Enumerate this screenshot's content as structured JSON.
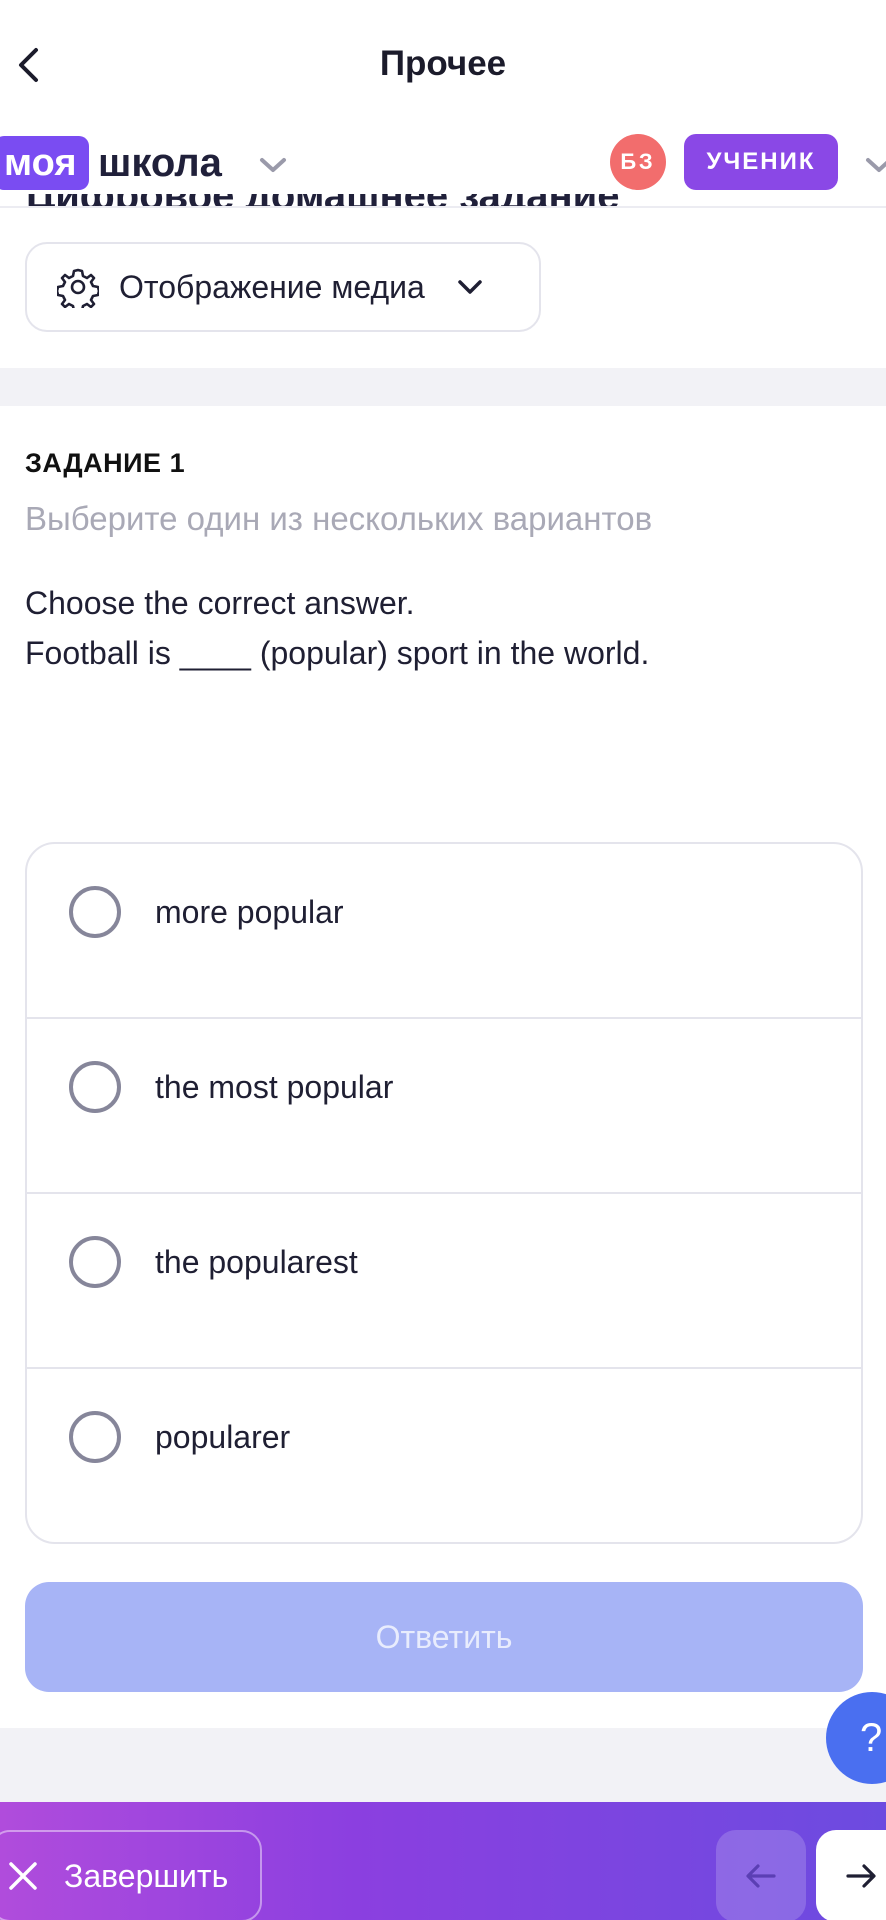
{
  "header": {
    "title": "Прочее"
  },
  "school": {
    "brand_badge": "моя",
    "brand_name": "школа",
    "avatar_initials": "БЗ",
    "role": "УЧЕНИК",
    "clipped_title": "Цифровое домашнее задание"
  },
  "media": {
    "label": "Отображение медиа"
  },
  "task": {
    "number": "ЗАДАНИЕ 1",
    "hint": "Выберите один из нескольких вариантов",
    "instruction": "Choose the correct answer.",
    "sentence": "Football is ____ (popular) sport in the world.",
    "options": [
      {
        "label": "more popular"
      },
      {
        "label": "the most popular"
      },
      {
        "label": "the popularest"
      },
      {
        "label": "popularer"
      }
    ],
    "submit_label": "Ответить"
  },
  "help": {
    "label": "?"
  },
  "footer": {
    "finish_label": "Завершить"
  },
  "colors": {
    "brand": "#7a4cf2",
    "avatar": "#f26d6d",
    "role": "#8a48e6",
    "submit_disabled": "#a7b4f6",
    "help": "#4a6ff0"
  }
}
